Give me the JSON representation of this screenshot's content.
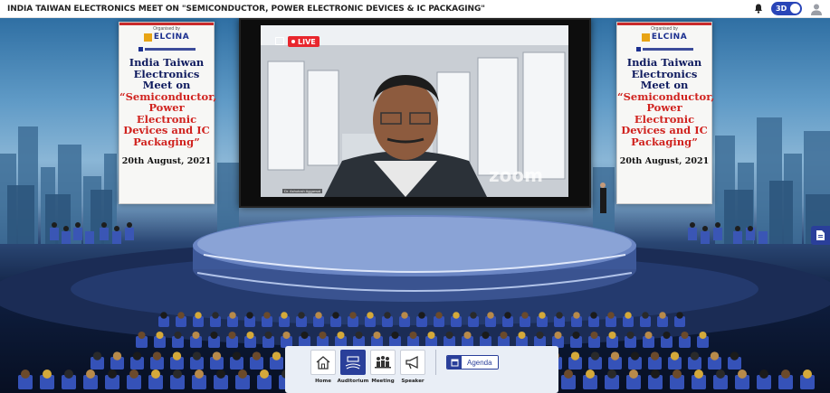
{
  "header": {
    "title": "INDIA TAIWAN ELECTRONICS MEET ON \"SEMICONDUCTOR, POWER ELECTRONIC DEVICES & IC PACKAGING\"",
    "toggle_label": "3D",
    "toggle_on": true,
    "icons": [
      "bell-icon",
      "user-icon"
    ]
  },
  "banners": {
    "organized_by": "Organised by",
    "logo_text": "ELCINA",
    "heading": "India Taiwan Electronics Meet on",
    "topic": "“Semiconductor, Power Electronic Devices and IC Packaging”",
    "date": "20th August, 2021"
  },
  "video": {
    "live_label": "LIVE",
    "speaker_name": "Dr. Ashutosh Aggarwal",
    "watermark": "zoom"
  },
  "nav": {
    "items": [
      {
        "label": "Home",
        "icon": "home-icon",
        "active": false
      },
      {
        "label": "Auditorium",
        "icon": "auditorium-icon",
        "active": true
      },
      {
        "label": "Meeting",
        "icon": "meeting-icon",
        "active": false
      },
      {
        "label": "Speaker",
        "icon": "megaphone-icon",
        "active": false
      }
    ],
    "agenda_label": "Agenda"
  },
  "colors": {
    "brand_blue": "#2a3f9a",
    "live_red": "#e8262d",
    "banner_red": "#d0231f",
    "banner_navy": "#0e1a5e"
  }
}
